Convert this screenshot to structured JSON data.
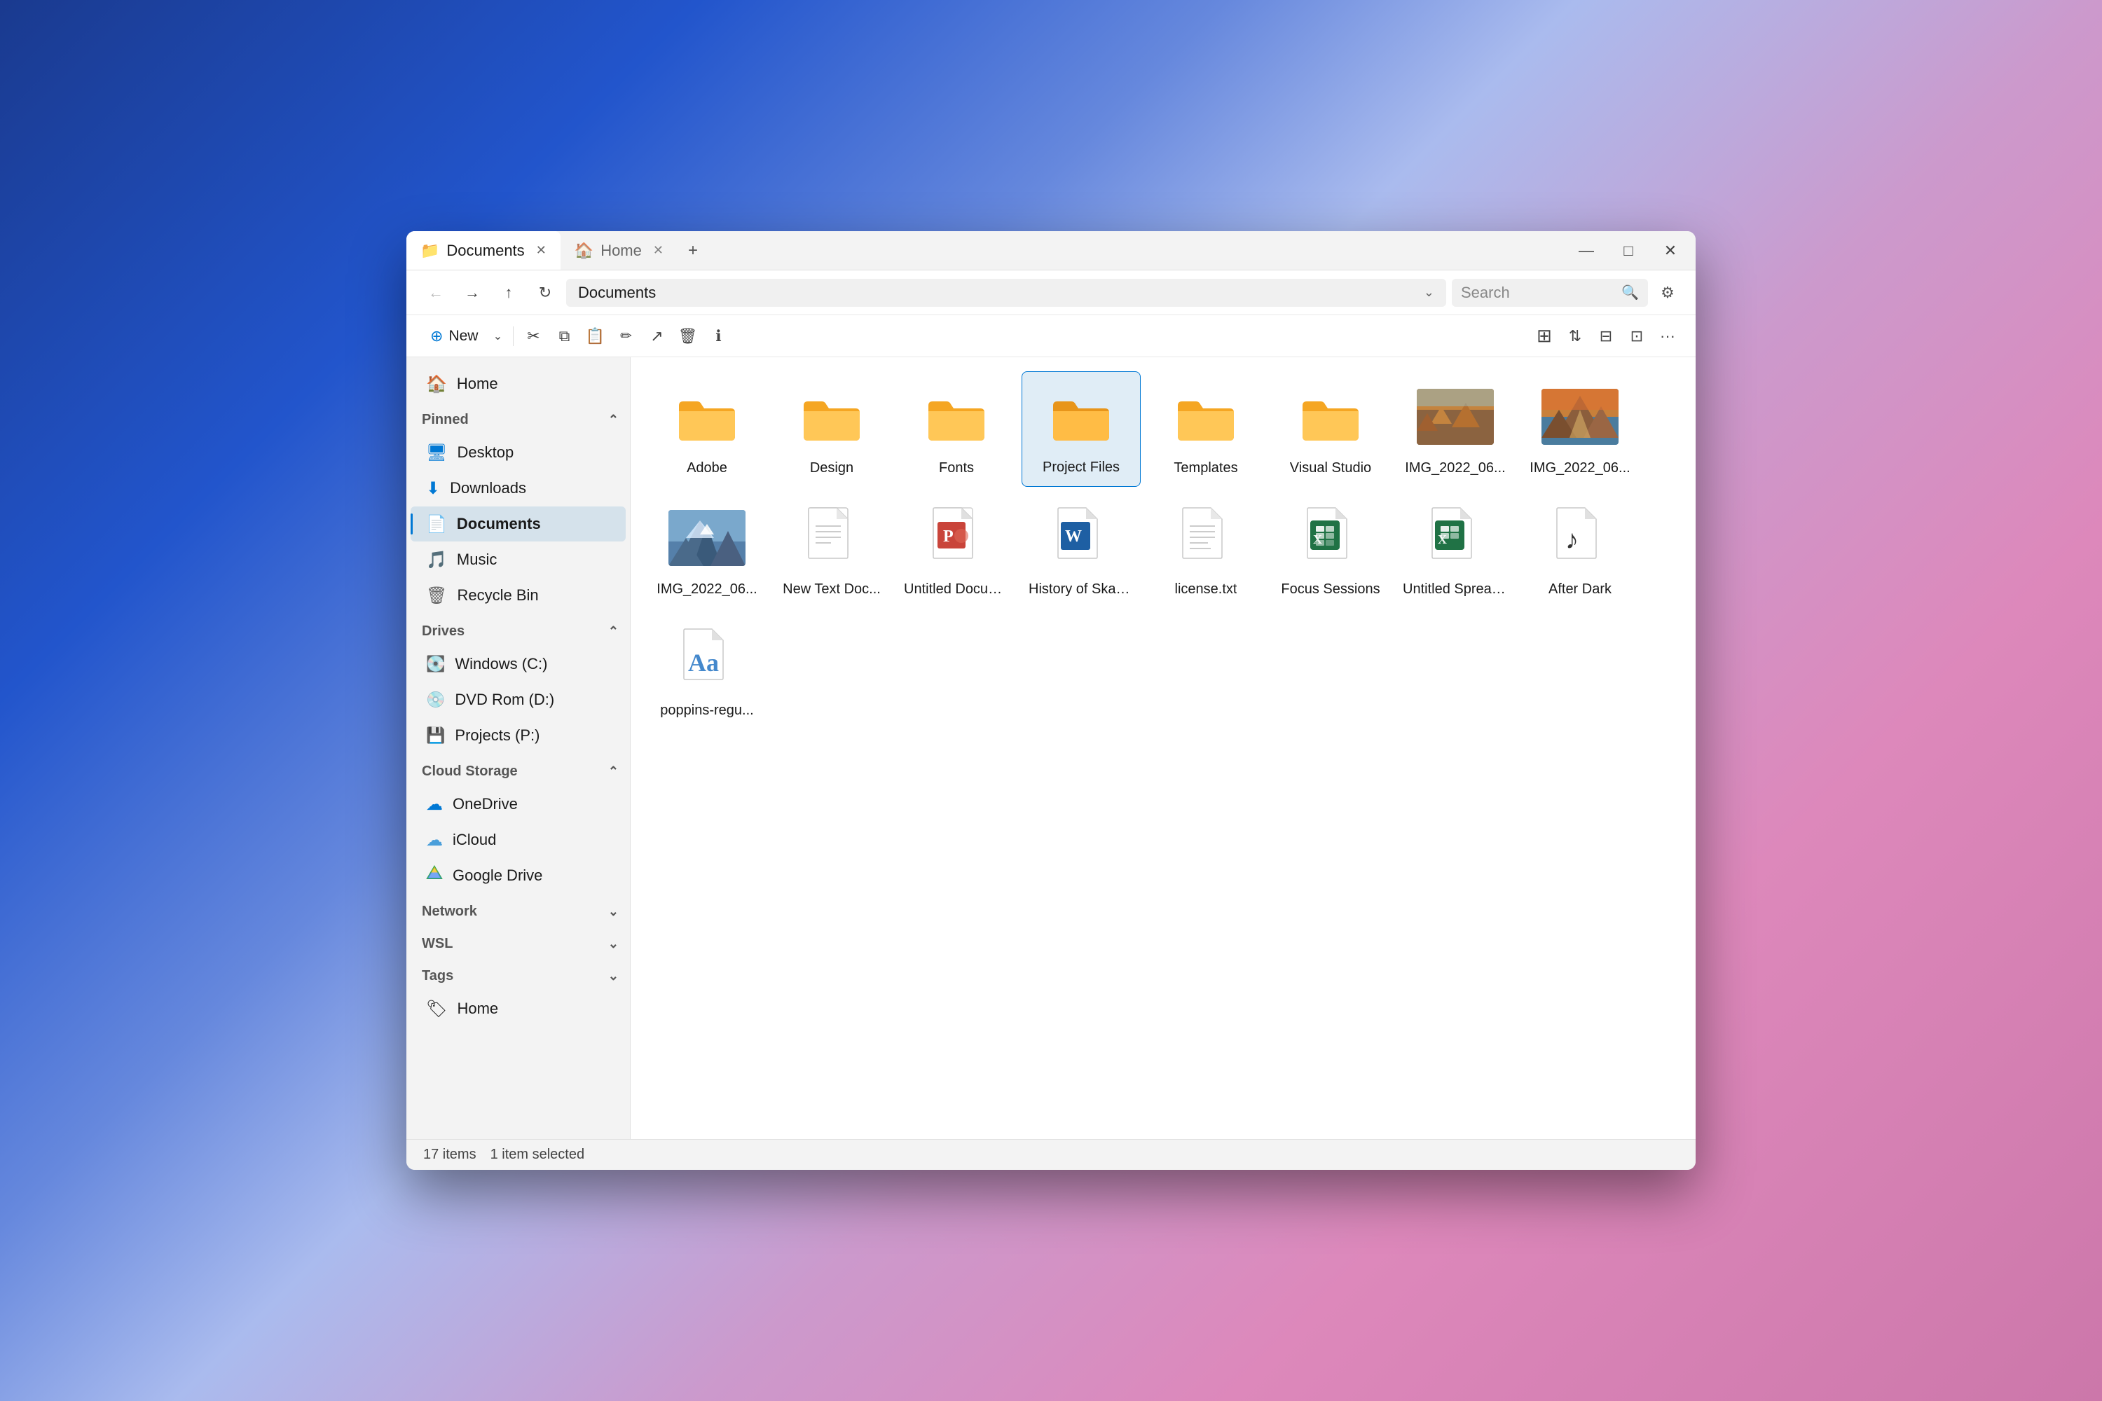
{
  "window": {
    "title": "Documents",
    "tab1_label": "Documents",
    "tab2_label": "Home",
    "minimize_label": "—",
    "maximize_label": "□",
    "close_label": "✕"
  },
  "toolbar": {
    "address": "Documents",
    "search_placeholder": "Search",
    "back_btn": "←",
    "forward_btn": "→",
    "up_btn": "↑",
    "refresh_btn": "↺"
  },
  "commands": {
    "new_label": "New",
    "cut_icon": "✂",
    "copy_icon": "⧉",
    "paste_icon": "📋",
    "rename_icon": "✏",
    "share_icon": "↗",
    "delete_icon": "🗑",
    "info_icon": "ℹ",
    "view1_icon": "⊞",
    "sort_icon": "⇅",
    "view2_icon": "⊟",
    "layout_icon": "⊡",
    "more_icon": "···"
  },
  "sidebar": {
    "home_label": "Home",
    "pinned_label": "Pinned",
    "desktop_label": "Desktop",
    "downloads_label": "Downloads",
    "documents_label": "Documents",
    "music_label": "Music",
    "recycle_label": "Recycle Bin",
    "drives_label": "Drives",
    "windows_c_label": "Windows (C:)",
    "dvd_d_label": "DVD Rom (D:)",
    "projects_p_label": "Projects (P:)",
    "cloud_label": "Cloud Storage",
    "onedrive_label": "OneDrive",
    "icloud_label": "iCloud",
    "gdrive_label": "Google Drive",
    "network_label": "Network",
    "wsl_label": "WSL",
    "tags_label": "Tags",
    "tags_home_label": "Home"
  },
  "files": [
    {
      "name": "Adobe",
      "type": "folder",
      "selected": false
    },
    {
      "name": "Design",
      "type": "folder",
      "selected": false
    },
    {
      "name": "Fonts",
      "type": "folder",
      "selected": false
    },
    {
      "name": "Project Files",
      "type": "folder",
      "selected": true
    },
    {
      "name": "Templates",
      "type": "folder",
      "selected": false
    },
    {
      "name": "Visual Studio",
      "type": "folder",
      "selected": false
    },
    {
      "name": "IMG_2022_06...",
      "type": "image_desert",
      "selected": false
    },
    {
      "name": "IMG_2022_06...",
      "type": "image_mountain",
      "selected": false
    },
    {
      "name": "IMG_2022_06...",
      "type": "image_snow",
      "selected": false
    },
    {
      "name": "New Text Doc...",
      "type": "txt",
      "selected": false
    },
    {
      "name": "Untitled Docum...",
      "type": "pptx",
      "selected": false
    },
    {
      "name": "History of Skate...",
      "type": "docx",
      "selected": false
    },
    {
      "name": "license.txt",
      "type": "txt2",
      "selected": false
    },
    {
      "name": "Focus Sessions",
      "type": "xlsx_green",
      "selected": false
    },
    {
      "name": "Untitled Spreads...",
      "type": "xlsx_green2",
      "selected": false
    },
    {
      "name": "After Dark",
      "type": "music",
      "selected": false
    },
    {
      "name": "poppins-regu...",
      "type": "font",
      "selected": false
    }
  ],
  "status": {
    "items": "17 items",
    "selected": "1 item selected"
  }
}
